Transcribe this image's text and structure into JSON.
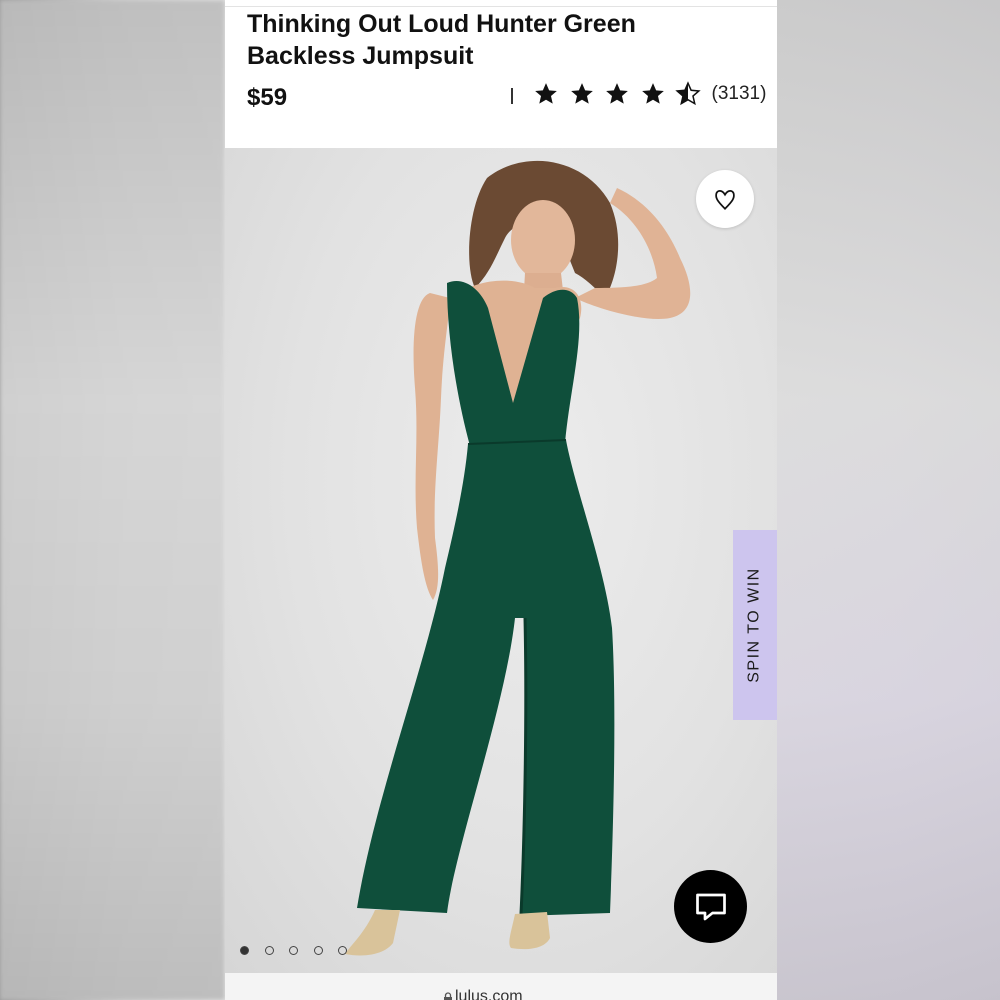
{
  "product": {
    "title": "Thinking Out Loud Hunter Green Backless Jumpsuit",
    "price": "$59",
    "rating": 4.5,
    "rating_max": 5,
    "review_count": "(3131)"
  },
  "actions": {
    "favorite_icon": "heart-icon",
    "spin_to_win_label": "SPIN TO WIN",
    "chat_icon": "chat-icon"
  },
  "carousel": {
    "total": 5,
    "active_index": 0
  },
  "browser": {
    "url": "lulus.com"
  },
  "colors": {
    "jumpsuit": "#0f4f3b",
    "spin_tab": "#cdc5ee",
    "chat_button": "#000000"
  }
}
